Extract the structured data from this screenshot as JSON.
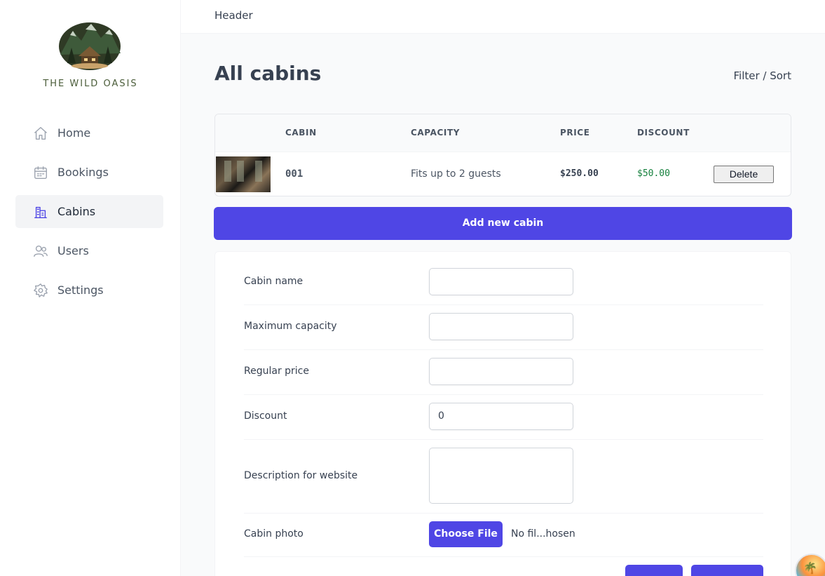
{
  "sidebar": {
    "brand": "THE WILD OASIS",
    "items": [
      {
        "label": "Home",
        "icon": "home-icon"
      },
      {
        "label": "Bookings",
        "icon": "calendar-icon"
      },
      {
        "label": "Cabins",
        "icon": "building-icon",
        "active": true
      },
      {
        "label": "Users",
        "icon": "users-icon"
      },
      {
        "label": "Settings",
        "icon": "gear-icon"
      }
    ]
  },
  "header": {
    "title": "Header"
  },
  "main": {
    "title": "All cabins",
    "filter_label": "Filter / Sort",
    "table": {
      "columns": [
        "",
        "CABIN",
        "CAPACITY",
        "PRICE",
        "DISCOUNT",
        ""
      ],
      "rows": [
        {
          "name": "001",
          "capacity": "Fits up to 2 guests",
          "price": "$250.00",
          "discount": "$50.00",
          "action": "Delete"
        }
      ]
    },
    "add_button": "Add new cabin",
    "form": {
      "fields": [
        {
          "label": "Cabin name",
          "value": ""
        },
        {
          "label": "Maximum capacity",
          "value": ""
        },
        {
          "label": "Regular price",
          "value": ""
        },
        {
          "label": "Discount",
          "value": "0"
        },
        {
          "label": "Description for website",
          "value": ""
        },
        {
          "label": "Cabin photo",
          "button": "Choose File",
          "status": "No fil...hosen"
        }
      ]
    }
  },
  "colors": {
    "accent": "#4f46e5",
    "discount": "#15803d",
    "brand": "#4b5d3a"
  }
}
